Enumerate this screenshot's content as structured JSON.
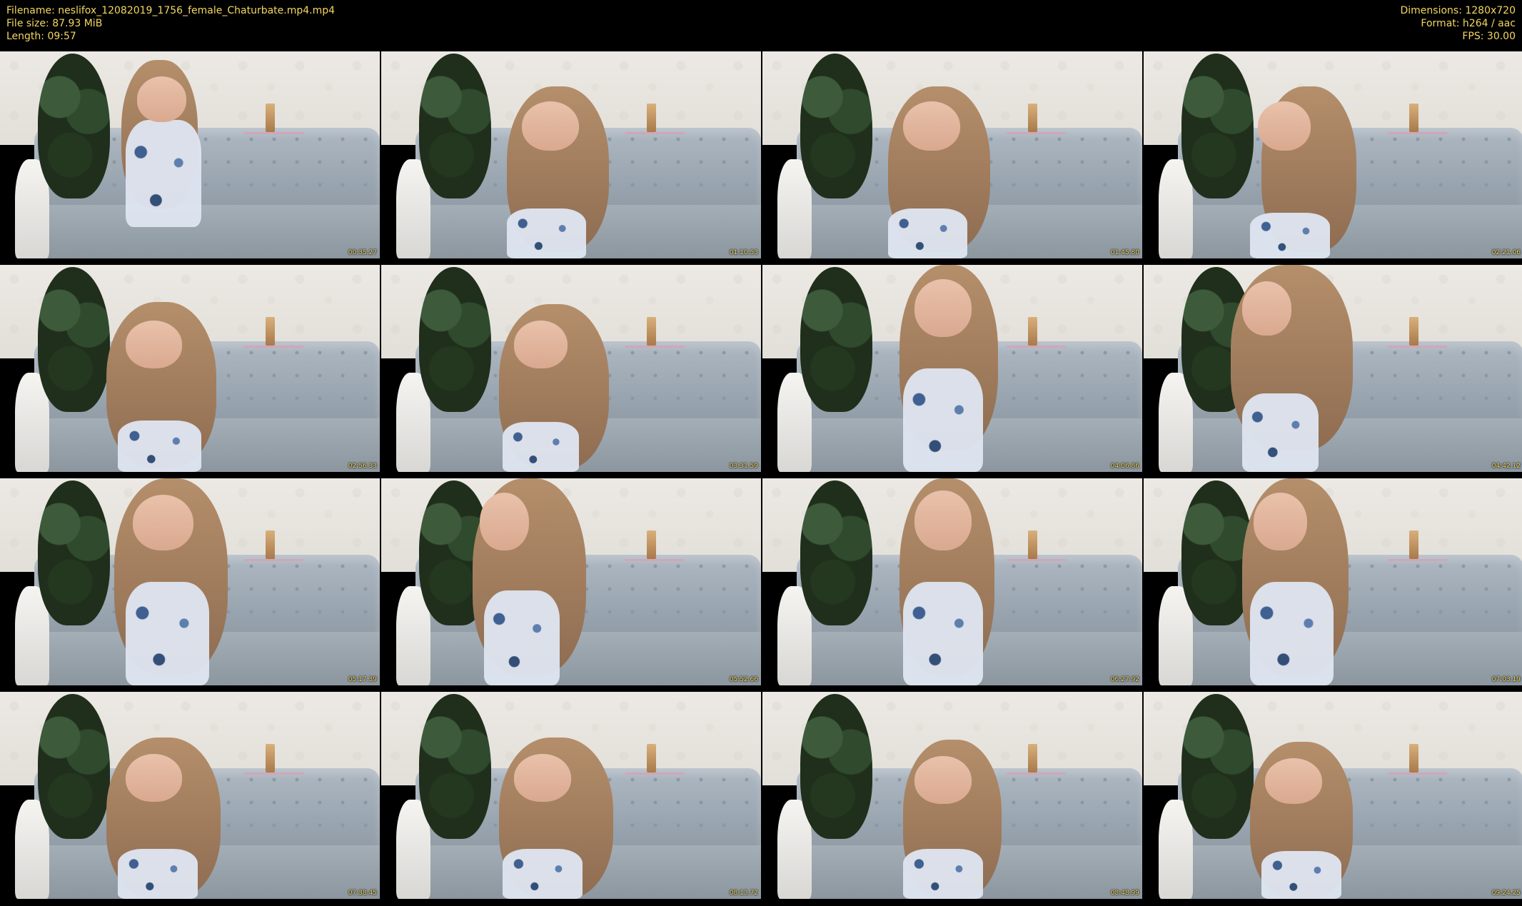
{
  "header": {
    "left_lines": [
      "Filename: neslifox_12082019_1756_female_Chaturbate.mp4.mp4",
      "File size: 87.93 MiB",
      "Length: 09:57"
    ],
    "right_lines": [
      "Dimensions: 1280x720",
      "Format: h264 / aac",
      "FPS: 30.00"
    ]
  },
  "thumbnails": [
    {
      "timestamp": "00:35.27"
    },
    {
      "timestamp": "01:10.53"
    },
    {
      "timestamp": "01:45.80"
    },
    {
      "timestamp": "02:21.06"
    },
    {
      "timestamp": "02:56.33"
    },
    {
      "timestamp": "03:31.59"
    },
    {
      "timestamp": "04:06.86"
    },
    {
      "timestamp": "04:42.12"
    },
    {
      "timestamp": "05:17.39"
    },
    {
      "timestamp": "05:52.66"
    },
    {
      "timestamp": "06:27.92"
    },
    {
      "timestamp": "07:03.19"
    },
    {
      "timestamp": "07:38.45"
    },
    {
      "timestamp": "08:13.72"
    },
    {
      "timestamp": "08:48.99"
    },
    {
      "timestamp": "09:24.25"
    }
  ]
}
